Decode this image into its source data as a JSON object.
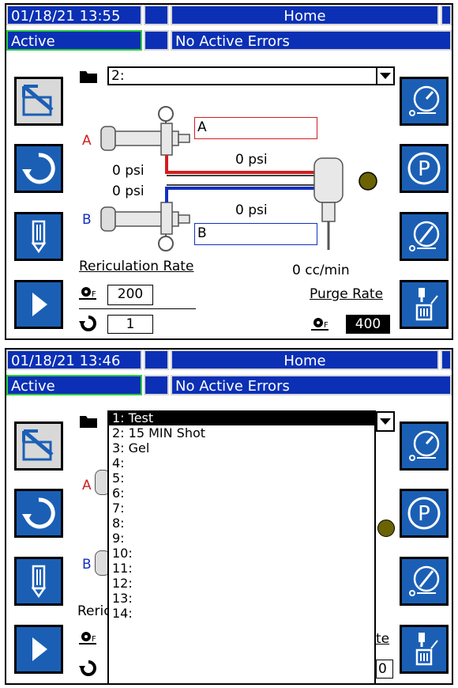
{
  "colors": {
    "header_blue": "#0b30b5",
    "button_blue": "#1b5fb5",
    "line_red": "#d21e1e",
    "line_blue": "#1230c0",
    "status_active_border": "#2ecc40",
    "indicator": "#6b6200"
  },
  "screen1": {
    "datetime": "01/18/21 13:55",
    "title": "Home",
    "status": "Active",
    "errors": "No Active Errors",
    "recipe_selected": "2:",
    "side_letter_a": "A",
    "side_letter_b": "B",
    "field_a_label": "A",
    "field_b_label": "B",
    "pressure_a_line": "0 psi",
    "pressure_a_gauge": "0 psi",
    "pressure_b_gauge": "0 psi",
    "pressure_b_line": "0 psi",
    "flow": "0 cc/min",
    "recirculation_label": "Rericulation Rate",
    "recirculation_rate": "200",
    "cycle_count": "1",
    "purge_label": "Purge Rate",
    "purge_rate": "400"
  },
  "screen2": {
    "datetime": "01/18/21 13:46",
    "title": "Home",
    "status": "Active",
    "errors": "No Active Errors",
    "side_letter_a": "A",
    "side_letter_b": "B",
    "partial_recirc": "Reric",
    "partial_purge": "te",
    "partial_value": "0",
    "recipes": [
      "1: Test",
      "2: 15 MIN Shot",
      "3: Gel",
      "4:",
      "5:",
      "6:",
      "7:",
      "8:",
      "9:",
      "10:",
      "11:",
      "12:",
      "13:",
      "14:"
    ]
  },
  "icons": {
    "pump_pressure": "gauge-icon",
    "park": "park-icon",
    "pressure_relief": "pressure-relief-icon",
    "purge": "purge-icon",
    "recipe_edit": "pencil-icon",
    "cycle": "cycle-icon",
    "advance": "play-icon",
    "setup": "setup-icon"
  }
}
